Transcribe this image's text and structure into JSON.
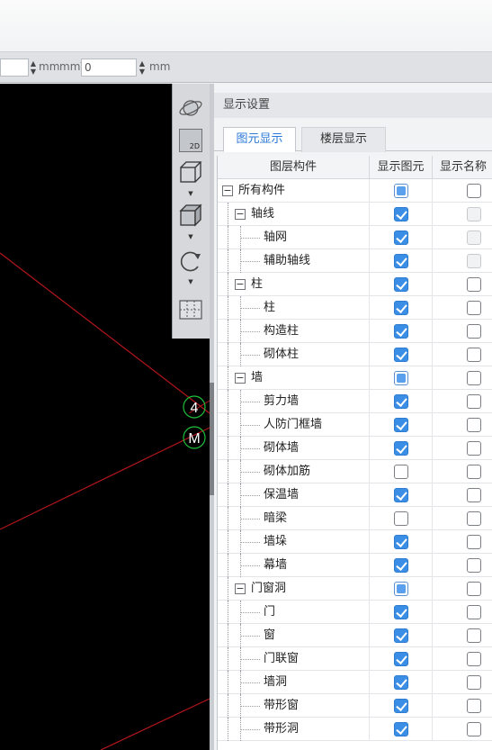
{
  "coordinates": {
    "x_unit": "mm",
    "y_label": "mmY=",
    "y_value": "0",
    "y_unit": "mm"
  },
  "canvas": {
    "markers": [
      {
        "label": "4",
        "color": "#1fbf3a"
      },
      {
        "label": "M",
        "color": "#1fbf3a"
      }
    ],
    "line_color": "#b3161b"
  },
  "toolbar": {
    "tools": [
      {
        "icon": "orbit-icon"
      },
      {
        "icon": "view-2d-icon",
        "label": "2D"
      },
      {
        "icon": "cube-view-icon"
      },
      {
        "icon": "cube-solid-icon"
      },
      {
        "icon": "rotate-icon"
      },
      {
        "icon": "layout-grid-icon"
      }
    ]
  },
  "panel": {
    "title": "显示设置",
    "tabs": [
      {
        "label": "图元显示",
        "active": true
      },
      {
        "label": "楼层显示",
        "active": false
      }
    ],
    "columns": [
      "图层构件",
      "显示图元",
      "显示名称"
    ],
    "rows": [
      {
        "name": "所有构件",
        "level": 0,
        "expander": "−",
        "show": "partial",
        "label": "unchecked"
      },
      {
        "name": "轴线",
        "level": 1,
        "expander": "−",
        "show": "checked",
        "label": "disabled"
      },
      {
        "name": "轴网",
        "level": 2,
        "show": "checked",
        "label": "disabled"
      },
      {
        "name": "辅助轴线",
        "level": 2,
        "show": "checked",
        "label": "disabled"
      },
      {
        "name": "柱",
        "level": 1,
        "expander": "−",
        "show": "checked",
        "label": "unchecked"
      },
      {
        "name": "柱",
        "level": 2,
        "show": "checked",
        "label": "unchecked"
      },
      {
        "name": "构造柱",
        "level": 2,
        "show": "checked",
        "label": "unchecked"
      },
      {
        "name": "砌体柱",
        "level": 2,
        "show": "checked",
        "label": "unchecked"
      },
      {
        "name": "墙",
        "level": 1,
        "expander": "−",
        "show": "partial",
        "label": "unchecked"
      },
      {
        "name": "剪力墙",
        "level": 2,
        "show": "checked",
        "label": "unchecked"
      },
      {
        "name": "人防门框墙",
        "level": 2,
        "show": "checked",
        "label": "unchecked"
      },
      {
        "name": "砌体墙",
        "level": 2,
        "show": "checked",
        "label": "unchecked"
      },
      {
        "name": "砌体加筋",
        "level": 2,
        "show": "unchecked",
        "label": "unchecked"
      },
      {
        "name": "保温墙",
        "level": 2,
        "show": "checked",
        "label": "unchecked"
      },
      {
        "name": "暗梁",
        "level": 2,
        "show": "unchecked",
        "label": "unchecked"
      },
      {
        "name": "墙垛",
        "level": 2,
        "show": "checked",
        "label": "unchecked"
      },
      {
        "name": "幕墙",
        "level": 2,
        "show": "checked",
        "label": "unchecked"
      },
      {
        "name": "门窗洞",
        "level": 1,
        "expander": "−",
        "show": "partial",
        "label": "unchecked"
      },
      {
        "name": "门",
        "level": 2,
        "show": "checked",
        "label": "unchecked"
      },
      {
        "name": "窗",
        "level": 2,
        "show": "checked",
        "label": "unchecked"
      },
      {
        "name": "门联窗",
        "level": 2,
        "show": "checked",
        "label": "unchecked"
      },
      {
        "name": "墙洞",
        "level": 2,
        "show": "checked",
        "label": "unchecked"
      },
      {
        "name": "带形窗",
        "level": 2,
        "show": "checked",
        "label": "unchecked"
      },
      {
        "name": "带形洞",
        "level": 2,
        "show": "checked",
        "label": "unchecked"
      }
    ]
  }
}
